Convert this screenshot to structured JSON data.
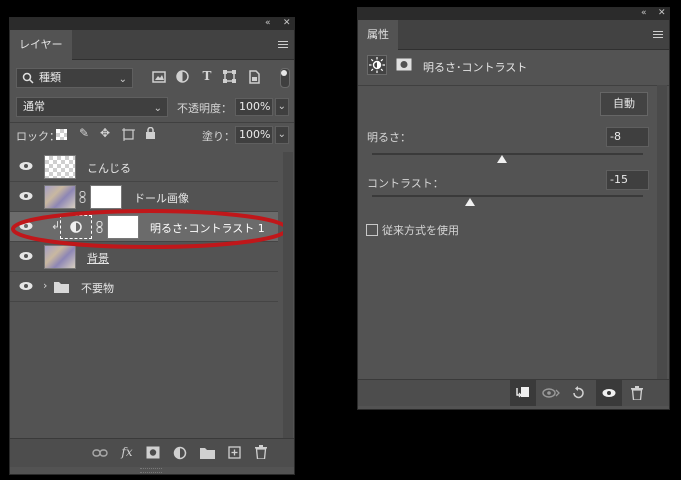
{
  "layers_panel": {
    "tab_label": "レイヤー",
    "filter_kind": "種類",
    "blend_mode": "通常",
    "opacity_label": "不透明度：",
    "opacity_value": "100%",
    "lock_label": "ロック：",
    "fill_label": "塗り：",
    "fill_value": "100%",
    "layers": [
      {
        "name": "こんじる"
      },
      {
        "name": "ドール画像"
      },
      {
        "name": "明るさ･コントラスト 1"
      },
      {
        "name": "背景"
      },
      {
        "name": "不要物"
      }
    ],
    "highlight_color": "#c0171a"
  },
  "properties_panel": {
    "tab_label": "属性",
    "adjustment_title": "明るさ･コントラスト",
    "auto_button": "自動",
    "brightness_label": "明るさ：",
    "brightness_value": "-8",
    "brightness_fraction": 0.48,
    "contrast_label": "コントラスト：",
    "contrast_value": "-15",
    "contrast_fraction": 0.36,
    "legacy_label": "従来方式を使用"
  },
  "icons": {
    "collapse": "«",
    "close": "✕",
    "type_text": "T",
    "fx": "fx"
  }
}
